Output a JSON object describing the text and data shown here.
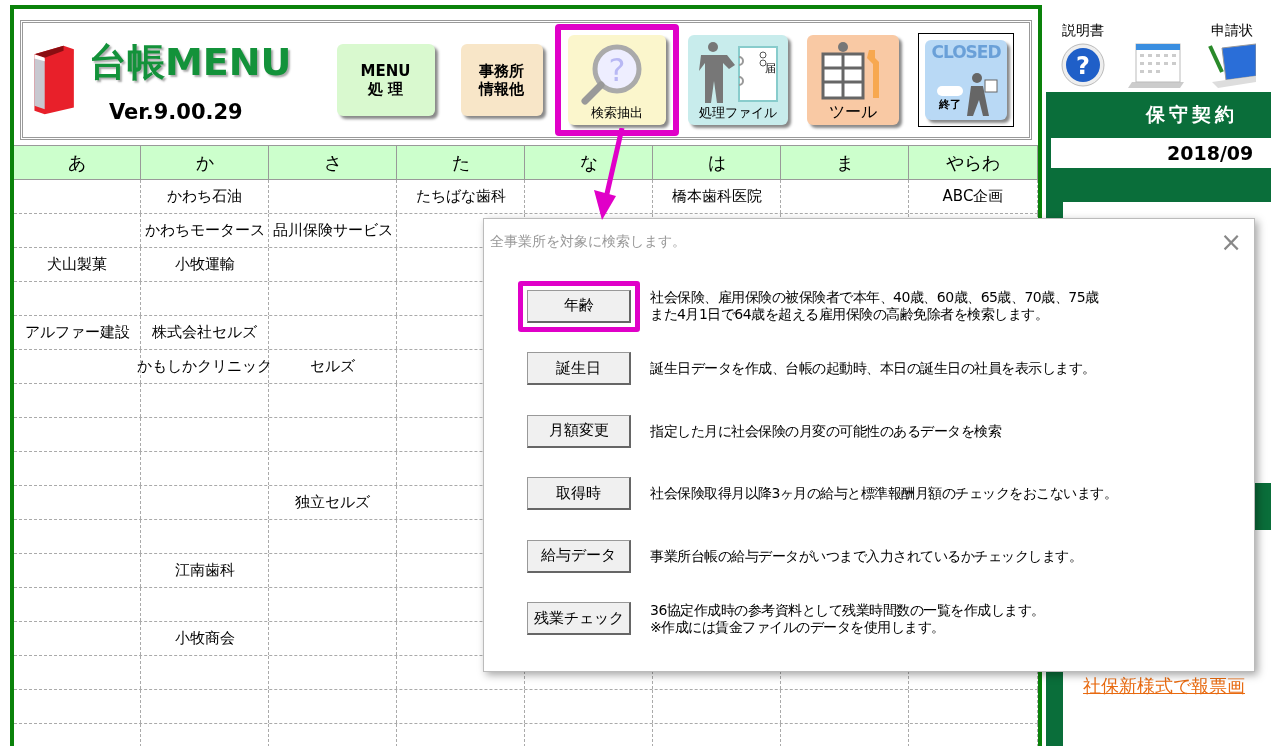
{
  "logo": {
    "title": "台帳MENU",
    "version": "Ver.9.00.29"
  },
  "toolbar": [
    {
      "kind": "text",
      "color": "#d9f9cf",
      "lines": [
        "MENU",
        "処 理"
      ],
      "highlighted": false
    },
    {
      "kind": "text",
      "color": "#f8e6c8",
      "lines": [
        "事務所",
        "情報他"
      ],
      "highlighted": false
    },
    {
      "kind": "search",
      "color": "#fbf6cc",
      "glyph": "?",
      "lines": [
        "検索抽出"
      ],
      "highlighted": true
    },
    {
      "kind": "file",
      "color": "#c8ecec",
      "lines": [
        "処理ファイル"
      ],
      "doc_text": "届",
      "highlighted": false
    },
    {
      "kind": "tool",
      "color": "#f9c9a4",
      "lines": [
        "ツール"
      ],
      "highlighted": false
    },
    {
      "kind": "closed",
      "color": "#b9d9f5",
      "lines": [
        "CLOSED",
        "終了"
      ],
      "highlighted": false
    }
  ],
  "index_table": {
    "columns": [
      "あ",
      "か",
      "さ",
      "た",
      "な",
      "は",
      "ま",
      "やらわ"
    ],
    "rows": [
      [
        "",
        "かわち石油",
        "",
        "たちばな歯科",
        "",
        "橋本歯科医院",
        "",
        "ABC企画"
      ],
      [
        "",
        "かわちモータース",
        "品川保険サービス",
        "",
        "",
        "",
        "",
        ""
      ],
      [
        "犬山製菓",
        "小牧運輸",
        "",
        "",
        "",
        "",
        "",
        ""
      ],
      [
        "",
        "",
        "",
        "",
        "",
        "",
        "",
        ""
      ],
      [
        "アルファー建設",
        "株式会社セルズ",
        "",
        "",
        "",
        "",
        "",
        ""
      ],
      [
        "",
        "かもしかクリニック",
        "セルズ",
        "",
        "",
        "",
        "",
        ""
      ],
      [
        "",
        "",
        "",
        "",
        "",
        "",
        "",
        ""
      ],
      [
        "",
        "",
        "",
        "",
        "",
        "",
        "",
        ""
      ],
      [
        "",
        "",
        "",
        "",
        "",
        "",
        "",
        ""
      ],
      [
        "",
        "",
        "独立セルズ",
        "",
        "",
        "",
        "",
        ""
      ],
      [
        "",
        "",
        "",
        "",
        "",
        "",
        "",
        ""
      ],
      [
        "",
        "江南歯科",
        "",
        "",
        "",
        "",
        "",
        ""
      ],
      [
        "",
        "",
        "",
        "",
        "",
        "",
        "",
        ""
      ],
      [
        "",
        "小牧商会",
        "",
        "",
        "",
        "",
        "",
        ""
      ],
      [
        "",
        "",
        "",
        "",
        "",
        "",
        "",
        ""
      ],
      [
        "",
        "",
        "",
        "",
        "",
        "",
        "",
        ""
      ],
      [
        "",
        "",
        "",
        "",
        "",
        "",
        "",
        ""
      ]
    ]
  },
  "side_panel": {
    "icons": [
      {
        "kind": "help",
        "label": "説明書",
        "glyph": "?"
      },
      {
        "kind": "calendar"
      },
      {
        "kind": "laptop",
        "label": "申請状"
      }
    ],
    "banner_title": "保守契約",
    "banner_date": "2018/09",
    "links": [
      {
        "kind": "band"
      },
      {
        "kind": "link",
        "text": "社保新様式で報票画"
      }
    ]
  },
  "search_dialog": {
    "title": "全事業所を対象に検索します。",
    "close": "×",
    "options": [
      {
        "button": "年齢",
        "highlighted": true,
        "description": [
          "社会保険、雇用保険の被保険者で本年、40歳、60歳、65歳、70歳、75歳",
          "また4月1日で64歳を超える雇用保険の高齢免除者を検索します。"
        ]
      },
      {
        "button": "誕生日",
        "highlighted": false,
        "description": [
          "誕生日データを作成、台帳の起動時、本日の誕生日の社員を表示します。"
        ]
      },
      {
        "button": "月額変更",
        "highlighted": false,
        "description": [
          "指定した月に社会保険の月変の可能性のあるデータを検索"
        ]
      },
      {
        "button": "取得時",
        "highlighted": false,
        "description": [
          "社会保険取得月以降3ヶ月の給与と標準報酬月額のチェックをおこないます。"
        ]
      },
      {
        "button": "給与データ",
        "highlighted": false,
        "description": [
          "事業所台帳の給与データがいつまで入力されているかチェックします。"
        ]
      },
      {
        "button": "残業チェック",
        "highlighted": false,
        "description": [
          "36協定作成時の参考資料として残業時間数の一覧を作成します。",
          "※作成には賃金ファイルのデータを使用します。"
        ]
      }
    ]
  }
}
